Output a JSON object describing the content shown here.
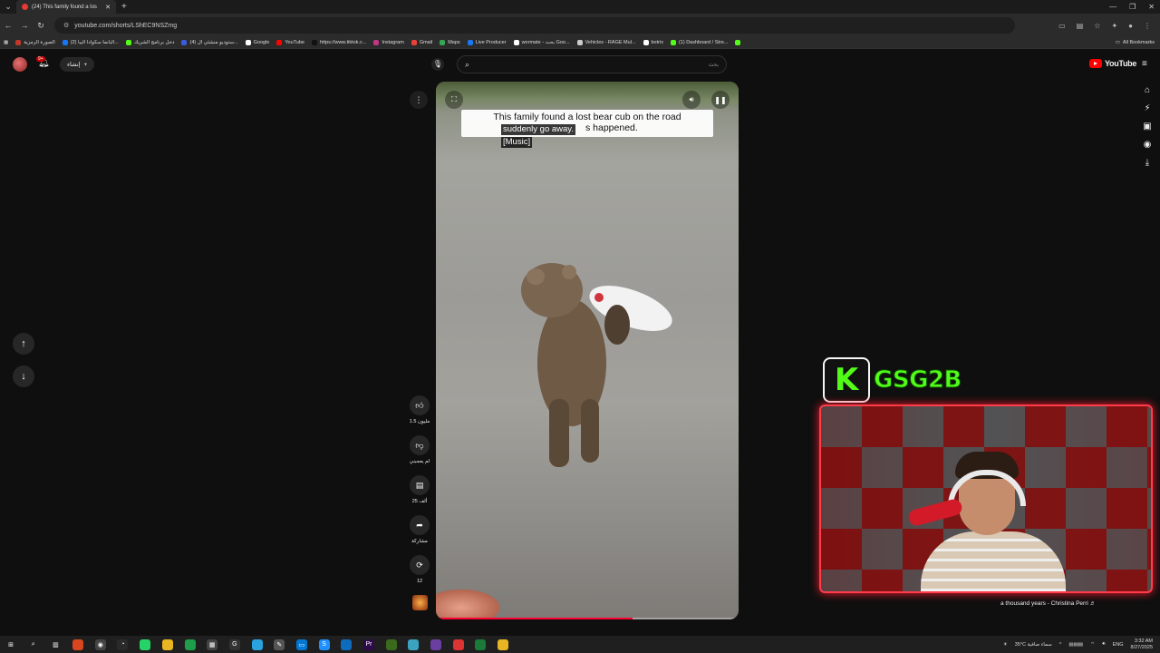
{
  "browser": {
    "tab_title": "(24) This family found a los",
    "url": "youtube.com/shorts/LShEC9NSZmg",
    "bookmarks": [
      {
        "label": "الصورة الرمزية",
        "color": "#c0392b"
      },
      {
        "label": "(2) البانما سكوادا البيا...",
        "color": "#1877f2"
      },
      {
        "label": "دخل برنامج الشريك",
        "color": "#53fc18"
      },
      {
        "label": "(4) ستوديو منشئي ال...",
        "color": "#3b5bdb"
      },
      {
        "label": "Google",
        "color": "#ffffff"
      },
      {
        "label": "YouTube",
        "color": "#ff0000"
      },
      {
        "label": "https://www.tiktok.c...",
        "color": "#111111"
      },
      {
        "label": "Instagram",
        "color": "#c13584"
      },
      {
        "label": "Gmail",
        "color": "#ea4335"
      },
      {
        "label": "Maps",
        "color": "#34a853"
      },
      {
        "label": "Live Producer",
        "color": "#1877f2"
      },
      {
        "label": "wormate - بحث Goo...",
        "color": "#ffffff"
      },
      {
        "label": "Vehicles - RAGE Mul...",
        "color": "#cccccc"
      },
      {
        "label": "botrix",
        "color": "#ffffff"
      },
      {
        "label": "(1) Dashboard / Stre...",
        "color": "#53fc18"
      },
      {
        "label": "",
        "color": "#53fc18"
      }
    ],
    "all_bookmarks": "All Bookmarks"
  },
  "youtube": {
    "create_label": "إنشاء",
    "notif_count": "9+",
    "search_placeholder": "بحث",
    "search_value": "",
    "logo_text": "YouTube"
  },
  "video": {
    "caption_line1": "This family found a lost bear cub on the road",
    "caption_line2": "suddenly go away.",
    "caption_line2_tail": "s happened.",
    "caption_line3": "[Music]",
    "progress": 0.65
  },
  "actions": {
    "like_count": "1.5 مليون",
    "dislike_label": "لم يعجبني",
    "comments_count": "25 ألف",
    "share_label": "مشاركة",
    "remix_count": "12"
  },
  "overlay": {
    "streamer_name": "GSG2B",
    "song": "a thousand years - Christina Perri ♬"
  },
  "taskbar": {
    "weather": "35°C  سماء صافية",
    "lang": "ENG",
    "time": "3:32 AM",
    "date": "8/27/2025"
  }
}
